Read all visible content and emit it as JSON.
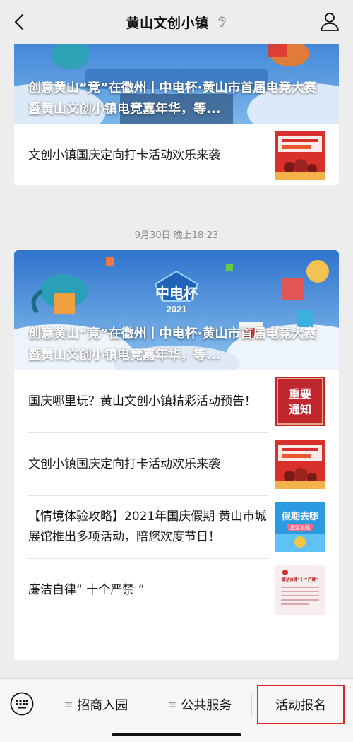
{
  "header": {
    "title": "黄山文创小镇"
  },
  "feed": {
    "card1": {
      "cover_title": "创意黄山“竞”在徽州丨中电杯·黄山市首届电竞大赛暨黄山文创小镇电竞嘉年华，等...",
      "items": [
        {
          "text": "文创小镇国庆定向打卡活动欢乐来袭",
          "thumb": "国庆定向打卡"
        }
      ]
    },
    "timestamp": "9月30日 晚上18:23",
    "card2": {
      "cover_title": "创意黄山“竞”在徽州丨中电杯·黄山市首届电竞大赛暨黄山文创小镇电竞嘉年华，等...",
      "cover_badge": "中电杯",
      "cover_year": "2021",
      "items": [
        {
          "text": "国庆哪里玩？黄山文创小镇精彩活动预告！",
          "thumb_line1": "重要",
          "thumb_line2": "通知"
        },
        {
          "text": "文创小镇国庆定向打卡活动欢乐来袭",
          "thumb": "国庆定向打卡"
        },
        {
          "text": "【情境体验攻略】2021年国庆假期 黄山市城展馆推出多项活动，陪您欢度节日！",
          "thumb": "假期去哪",
          "thumb_sub": "旅游攻略"
        },
        {
          "text": "廉洁自律“ 十个严禁 ”",
          "thumb": "廉洁自律“十个严禁”"
        }
      ]
    }
  },
  "bottom_menu": {
    "items": [
      {
        "label": "招商入园"
      },
      {
        "label": "公共服务"
      },
      {
        "label": "活动报名"
      }
    ]
  },
  "colors": {
    "highlight_border": "#e02020",
    "background": "#ededed"
  }
}
